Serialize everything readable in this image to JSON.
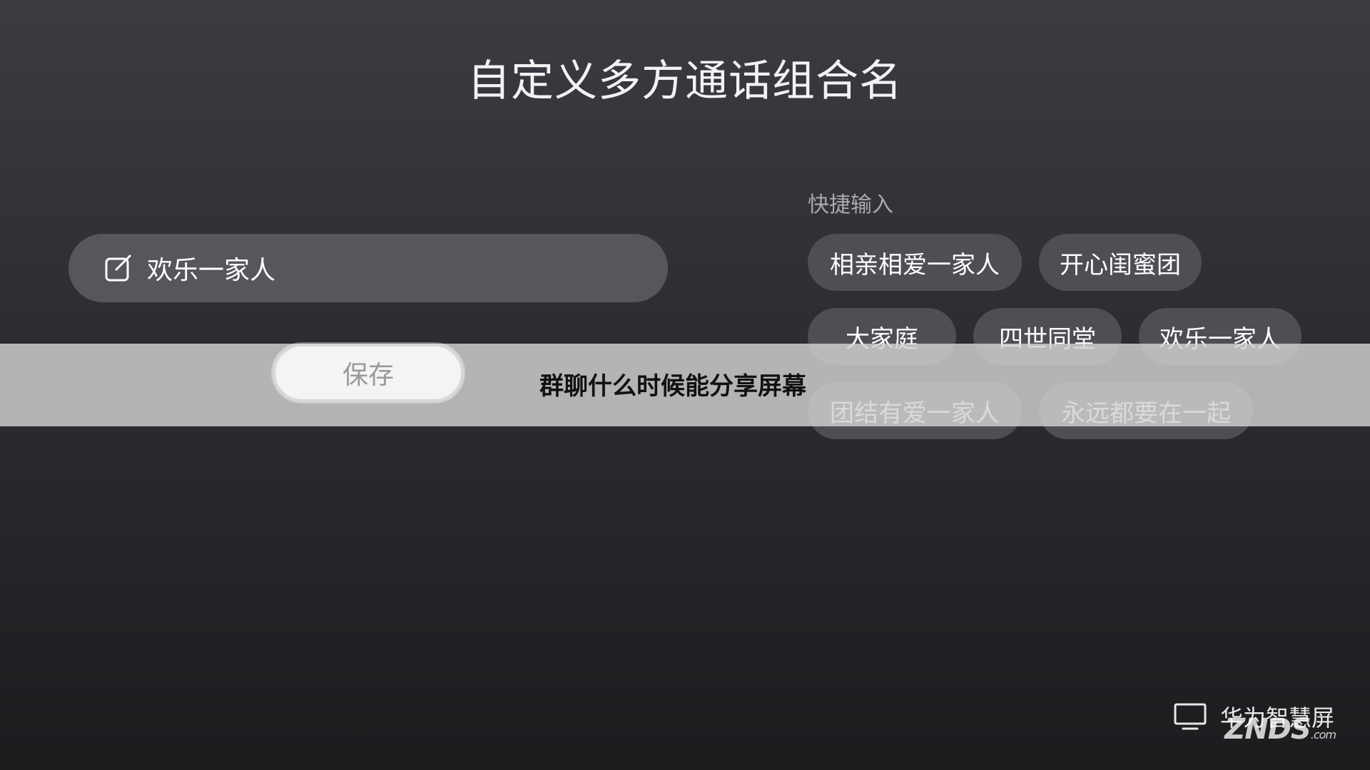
{
  "header": {
    "title": "自定义多方通话组合名"
  },
  "name_input": {
    "value": "欢乐一家人",
    "icon": "edit-icon"
  },
  "save_button": {
    "label": "保存"
  },
  "quick_input": {
    "label": "快捷输入",
    "chips": [
      "相亲相爱一家人",
      "开心闺蜜团",
      "大家庭",
      "四世同堂",
      "欢乐一家人",
      "团结有爱一家人",
      "永远都要在一起"
    ]
  },
  "overlay": {
    "caption": "群聊什么时候能分享屏幕"
  },
  "brand": {
    "icon": "tv-icon",
    "name": "华为智慧屏"
  },
  "watermark": {
    "text": "ZNDS",
    "suffix": ".com"
  },
  "colors": {
    "background_top": "#3a3c41",
    "background_bottom": "#1b1c1e",
    "input_bg": "#55575b",
    "chip_bg": "#4d4f53",
    "save_bg": "#f4f4f4",
    "overlay_band": "#d2d2d2"
  }
}
